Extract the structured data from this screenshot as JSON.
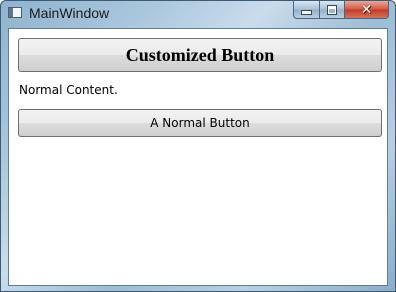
{
  "window": {
    "title": "MainWindow",
    "icon": "window-app-icon",
    "controls": {
      "minimize_icon": "minimize-icon",
      "maximize_icon": "maximize-icon",
      "close_glyph": "✕"
    }
  },
  "content": {
    "custom_button_label": "Customized Button",
    "normal_text": "Normal Content.",
    "normal_button_label": "A Normal Button"
  },
  "colors": {
    "titlebar_accent": "#a9c6dc",
    "close_button": "#c23b22",
    "button_border": "#707070"
  }
}
